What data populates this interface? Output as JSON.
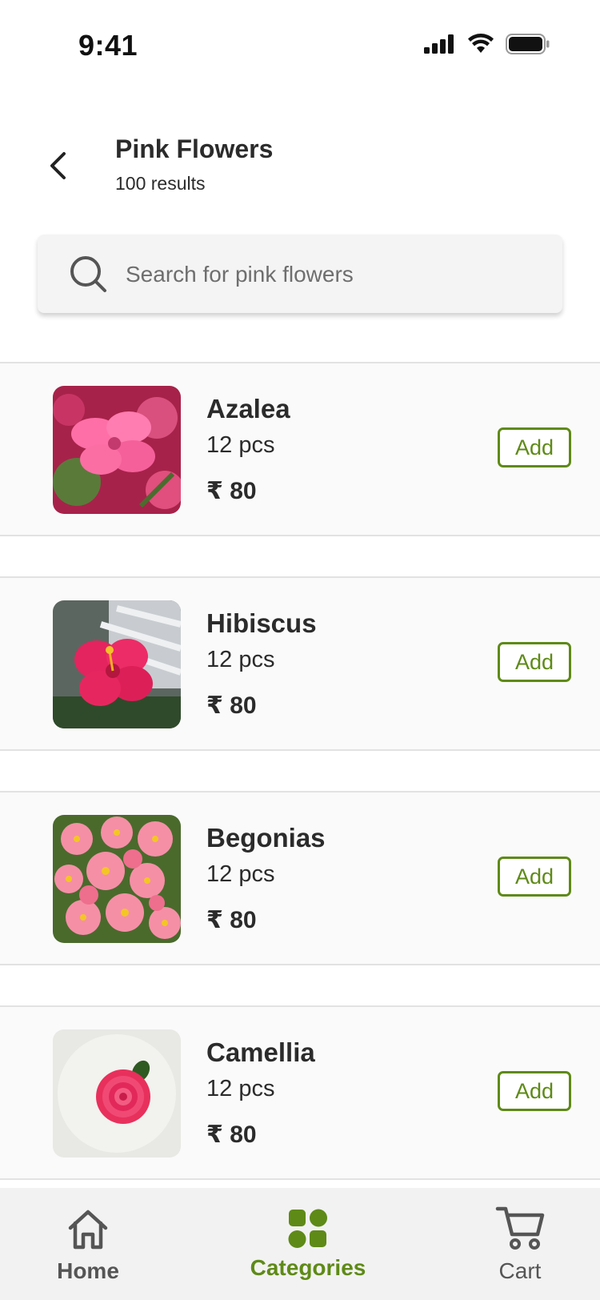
{
  "status_bar": {
    "time": "9:41"
  },
  "header": {
    "title": "Pink Flowers",
    "subtitle": "100 results"
  },
  "search": {
    "placeholder": "Search for pink flowers"
  },
  "products": [
    {
      "name": "Azalea",
      "qty": "12 pcs",
      "price": "₹ 80",
      "add_label": "Add"
    },
    {
      "name": "Hibiscus",
      "qty": "12 pcs",
      "price": "₹ 80",
      "add_label": "Add"
    },
    {
      "name": "Begonias",
      "qty": "12 pcs",
      "price": "₹ 80",
      "add_label": "Add"
    },
    {
      "name": "Camellia",
      "qty": "12 pcs",
      "price": "₹ 80",
      "add_label": "Add"
    }
  ],
  "tabs": [
    {
      "label": "Home",
      "icon": "home-icon",
      "active": false
    },
    {
      "label": "Categories",
      "icon": "categories-icon",
      "active": true
    },
    {
      "label": "Cart",
      "icon": "cart-icon",
      "active": false
    }
  ],
  "colors": {
    "accent": "#5e8a17",
    "text": "#2b2b2b",
    "tabbar": "#f2f2f2"
  }
}
